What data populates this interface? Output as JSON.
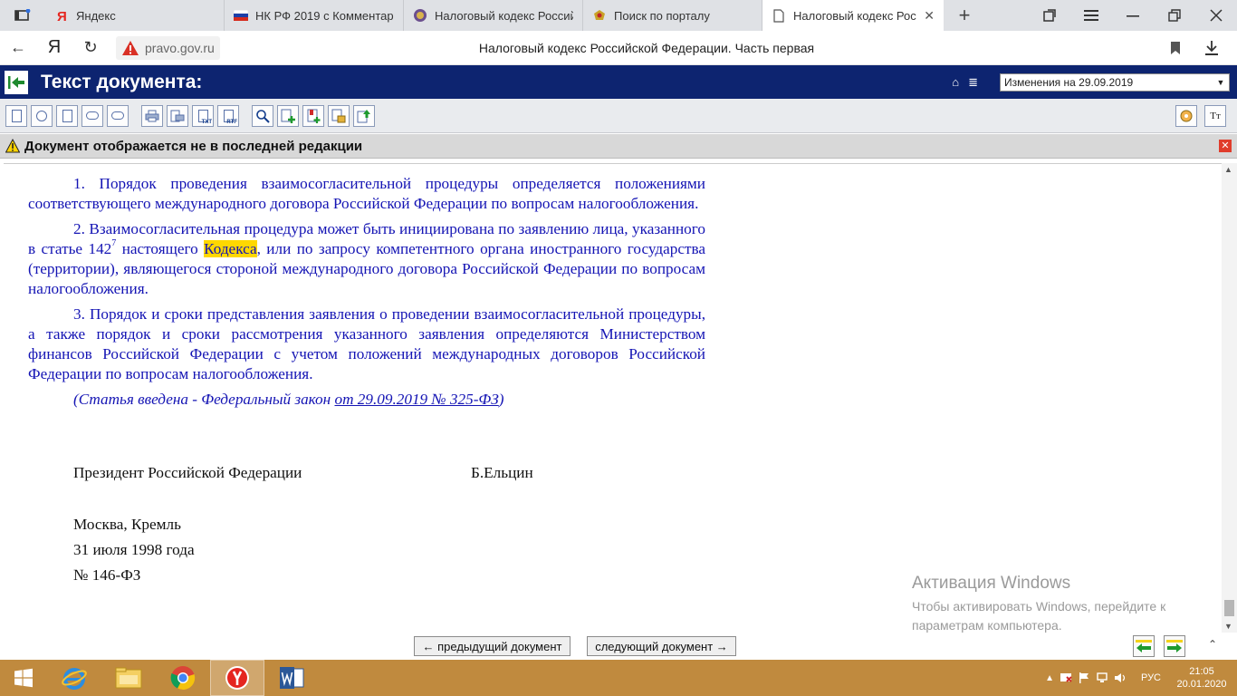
{
  "browser": {
    "tabs": [
      {
        "title": "Яндекс",
        "icon": "yandex-icon"
      },
      {
        "title": "НК РФ 2019 с Комментари",
        "icon": "russia-flag-icon"
      },
      {
        "title": "Налоговый кодекс Россий",
        "icon": "emblem-icon"
      },
      {
        "title": "Поиск по порталу",
        "icon": "eagle-icon"
      },
      {
        "title": "Налоговый кодекс Росс",
        "icon": "document-icon",
        "active": true
      }
    ],
    "url": "pravo.gov.ru",
    "page_title": "Налоговый кодекс Российской Федерации. Часть первая",
    "yandex_letter": "Я"
  },
  "doc_header": {
    "title": "Текст документа:",
    "edition_selected": "Изменения на 29.09.2019"
  },
  "toolbar": {
    "txt_label": "TXT",
    "rtf_label": "RTF",
    "tt_label": "Tт"
  },
  "warning": {
    "text": "Документ отображается не в последней редакции"
  },
  "document": {
    "p1": "1. Порядок проведения взаимосогласительной процедуры определяется положениями соответствующего международного договора Российской Федерации по вопросам налогообложения.",
    "p2_before": "2. Взаимосогласительная процедура может быть инициирована по заявлению лица, указанного в статье 142",
    "p2_sup": "7",
    "p2_mid": " настоящего ",
    "p2_highlight": "Кодекса",
    "p2_after": ", или по запросу компетентного органа иностранного государства (территории), являющегося стороной международного договора Российской Федерации по вопросам налогообложения.",
    "p3": "3. Порядок и сроки представления заявления о проведении взаимосогласительной процедуры, а также порядок и сроки рассмотрения указанного заявления определяются Министерством финансов Российской Федерации с учетом положений международных договоров Российской Федерации по вопросам налогообложения.",
    "note_prefix": "(Статья введена - Федеральный закон ",
    "note_link": "от 29.09.2019 № 325-ФЗ",
    "note_suffix": ")",
    "president_title": "Президент Российской Федерации",
    "president_name": "Б.Ельцин",
    "place": "Москва, Кремль",
    "date": "31 июля 1998 года",
    "number": "№ 146-ФЗ"
  },
  "watermark": {
    "title": "Активация Windows",
    "line1": "Чтобы активировать Windows, перейдите к",
    "line2": "параметрам компьютера."
  },
  "bottom_nav": {
    "prev": "← предыдущий документ",
    "next": "следующий документ →"
  },
  "taskbar": {
    "lang": "РУС",
    "time": "21:05",
    "date": "20.01.2020"
  },
  "colors": {
    "doc_text": "#1414b4",
    "header_bg": "#0d2470",
    "highlight": "#ffd800",
    "taskbar": "#c08a3e"
  }
}
